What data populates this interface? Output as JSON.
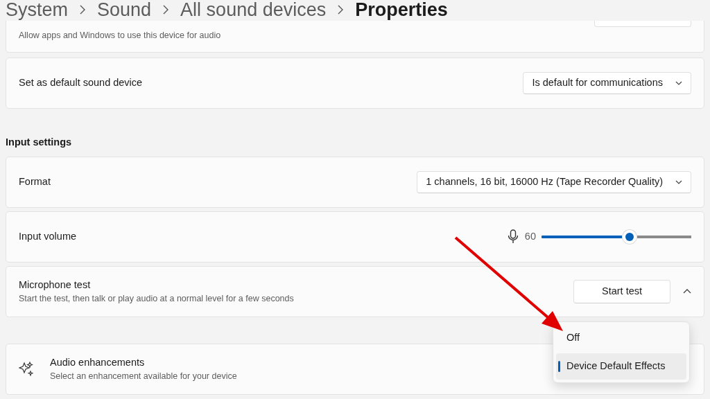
{
  "breadcrumb": [
    {
      "label": "System",
      "current": false
    },
    {
      "label": "Sound",
      "current": false
    },
    {
      "label": "All sound devices",
      "current": false
    },
    {
      "label": "Properties",
      "current": true
    }
  ],
  "top_card": {
    "description": "Allow apps and Windows to use this device for audio"
  },
  "output_cards": [
    {
      "kind": "dropdown",
      "title": "Set as default sound device",
      "value": "Is default for communications"
    }
  ],
  "input_settings": {
    "heading": "Input settings",
    "cards": [
      {
        "kind": "dropdown",
        "title": "Format",
        "value": "1 channels, 16 bit, 16000 Hz (Tape Recorder Quality)"
      },
      {
        "kind": "slider",
        "title": "Input volume",
        "reading": "60",
        "level": 0.6
      },
      {
        "kind": "button",
        "title": "Microphone test",
        "description": "Start the test, then talk or play audio at a normal level for a few seconds",
        "button": "Start test",
        "expanded": true
      }
    ]
  },
  "enhancements": {
    "title": "Audio enhancements",
    "description": "Select an enhancement available for your device"
  },
  "enhancement_menu": [
    {
      "label": "Off",
      "selected": false
    },
    {
      "label": "Device Default Effects",
      "selected": true
    }
  ]
}
